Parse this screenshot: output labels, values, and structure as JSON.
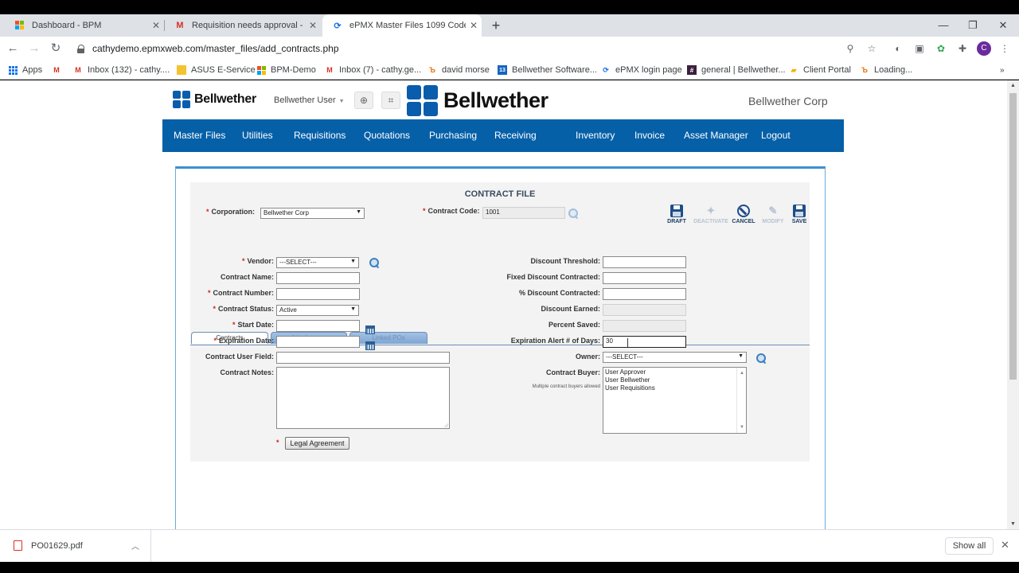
{
  "browser": {
    "tabs": [
      {
        "title": "Dashboard - BPM",
        "favicon": "windows-logo-icon"
      },
      {
        "title": "Requisition needs approval - sen",
        "favicon": "gmail-icon"
      },
      {
        "title": "ePMX Master Files 1099 Code",
        "favicon": "loading-spinner-icon"
      }
    ],
    "url": "cathydemo.epmxweb.com/master_files/add_contracts.php",
    "avatar_letter": "C",
    "bookmarks": [
      "Apps",
      "Inbox (132) - cathy....",
      "ASUS E-Service",
      "BPM-Demo",
      "Inbox (7) - cathy.ge...",
      "david morse",
      "Bellwether Software...",
      "ePMX login page",
      "general | Bellwether...",
      "Client Portal",
      "Loading..."
    ]
  },
  "header": {
    "logo_text": "Bellwether",
    "user_menu": "Bellwether User",
    "big_logo_text": "Bellwether",
    "corp_name": "Bellwether Corp"
  },
  "nav": [
    "Master Files",
    "Utilities",
    "Requisitions",
    "Quotations",
    "Purchasing",
    "Receiving",
    "Inventory",
    "Invoice",
    "Asset Manager",
    "Logout"
  ],
  "form": {
    "title": "CONTRACT FILE",
    "corporation_label": "Corporation:",
    "corporation_value": "Bellwether Corp",
    "contract_code_label": "Contract Code:",
    "contract_code_value": "1001",
    "toolbar": {
      "draft": "DRAFT",
      "deactivate": "DEACTIVATE",
      "cancel": "CANCEL",
      "modify": "MODIFY",
      "save": "SAVE"
    },
    "tabs": [
      "Contracts",
      "Attachments",
      "Linked POs"
    ],
    "left": {
      "vendor_label": "Vendor:",
      "vendor_value": "---SELECT---",
      "contract_name_label": "Contract Name:",
      "contract_number_label": "Contract Number:",
      "contract_status_label": "Contract Status:",
      "contract_status_value": "Active",
      "start_date_label": "Start Date:",
      "expiration_date_label": "Expiration Date:",
      "user_field_label": "Contract User Field:",
      "notes_label": "Contract Notes:",
      "legal_button": "Legal Agreement"
    },
    "right": {
      "discount_threshold_label": "Discount Threshold:",
      "fixed_discount_label": "Fixed Discount Contracted:",
      "pct_discount_label": "% Discount Contracted:",
      "discount_earned_label": "Discount Earned:",
      "percent_saved_label": "Percent Saved:",
      "expiration_alert_label": "Expiration Alert # of Days:",
      "expiration_alert_value": "30",
      "owner_label": "Owner:",
      "owner_value": "---SELECT---",
      "buyer_label": "Contract Buyer:",
      "buyer_hint": "Multiple contract buyers allowed",
      "buyers": [
        "User Approver",
        "User Bellwether",
        "User Requisitions"
      ]
    }
  },
  "downloads": {
    "file": "PO01629.pdf",
    "show_all": "Show all"
  },
  "colors": {
    "nav_bg": "#0660a8",
    "brand_blue": "#0a5cad",
    "required": "#d02020"
  }
}
